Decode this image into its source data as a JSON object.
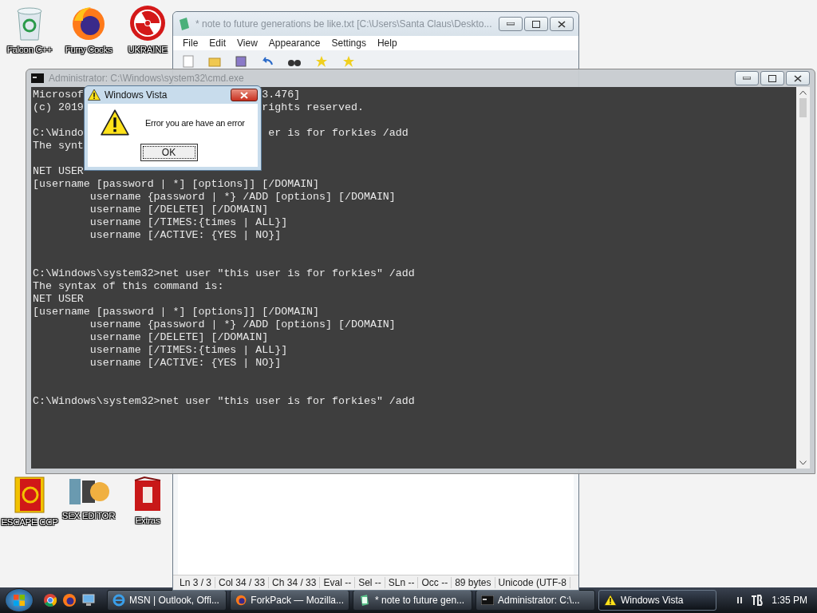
{
  "desktop_icons": {
    "top_row": [
      {
        "label": "Falcon C++",
        "kind": "bin"
      },
      {
        "label": "Furry Cocks",
        "kind": "browser"
      },
      {
        "label": "UKRAINE",
        "kind": "hazard"
      }
    ],
    "bottom_row": [
      {
        "label": "ESCAPE CCP",
        "kind": "book"
      },
      {
        "label": "SEX EDITOR",
        "kind": "hex"
      },
      {
        "label": "Extras",
        "kind": "box"
      }
    ]
  },
  "notepad": {
    "title": "* note to future generations be like.txt [C:\\Users\\Santa Claus\\Deskto...",
    "menu": [
      "File",
      "Edit",
      "View",
      "Appearance",
      "Settings",
      "Help"
    ],
    "status_bar": [
      "Ln 3 / 3",
      "Col 34 / 33",
      "Ch 34 / 33",
      "Eval --",
      "Sel --",
      "SLn --",
      "Occ --",
      "89 bytes",
      "Unicode (UTF-8"
    ]
  },
  "console": {
    "title": "Administrator: C:\\Windows\\system32\\cmd.exe",
    "lines": [
      {
        "kind": "text",
        "text": "Microsof",
        "tail": "3.476]"
      },
      {
        "kind": "text",
        "text": "(c) 2019",
        "tail": "rights reserved."
      },
      {
        "kind": "blank"
      },
      {
        "kind": "text",
        "text": "C:\\Windo",
        "tail": " er is for forkies /add"
      },
      {
        "kind": "text",
        "text": "The synt"
      },
      {
        "kind": "blank"
      },
      {
        "kind": "text",
        "text": "NET USER"
      },
      {
        "kind": "text",
        "text": "[username [password | *] [options]] [/DOMAIN]"
      },
      {
        "kind": "text",
        "text": "         username {password | *} /ADD [options] [/DOMAIN]"
      },
      {
        "kind": "text",
        "text": "         username [/DELETE] [/DOMAIN]"
      },
      {
        "kind": "text",
        "text": "         username [/TIMES:{times | ALL}]"
      },
      {
        "kind": "text",
        "text": "         username [/ACTIVE: {YES | NO}]"
      },
      {
        "kind": "blank"
      },
      {
        "kind": "blank"
      },
      {
        "kind": "text",
        "text": "C:\\Windows\\system32>net user \"this user is for forkies\" /add"
      },
      {
        "kind": "text",
        "text": "The syntax of this command is:"
      },
      {
        "kind": "text",
        "text": "NET USER"
      },
      {
        "kind": "text",
        "text": "[username [password | *] [options]] [/DOMAIN]"
      },
      {
        "kind": "text",
        "text": "         username {password | *} /ADD [options] [/DOMAIN]"
      },
      {
        "kind": "text",
        "text": "         username [/DELETE] [/DOMAIN]"
      },
      {
        "kind": "text",
        "text": "         username [/TIMES:{times | ALL}]"
      },
      {
        "kind": "text",
        "text": "         username [/ACTIVE: {YES | NO}]"
      },
      {
        "kind": "blank"
      },
      {
        "kind": "blank"
      },
      {
        "kind": "text",
        "text": "C:\\Windows\\system32>net user \"this user is for forkies\" /add"
      }
    ]
  },
  "dialog": {
    "title": "Windows Vista",
    "message": "Error you are have an error",
    "button": "OK"
  },
  "taskbar": {
    "quick_launch": [
      {
        "kind": "chrome"
      },
      {
        "kind": "firefox"
      },
      {
        "kind": "computer"
      }
    ],
    "items": [
      {
        "label": "MSN | Outlook, Offi...",
        "kind": "ie",
        "selected": false
      },
      {
        "label": "ForkPack — Mozilla...",
        "kind": "firefox",
        "selected": false
      },
      {
        "label": "* note to future gen...",
        "kind": "notepad",
        "selected": false
      },
      {
        "label": "Administrator: C:\\...",
        "kind": "console",
        "selected": false
      },
      {
        "label": "Windows Vista",
        "kind": "warning",
        "selected": true
      }
    ],
    "clock": "1:35 PM"
  }
}
